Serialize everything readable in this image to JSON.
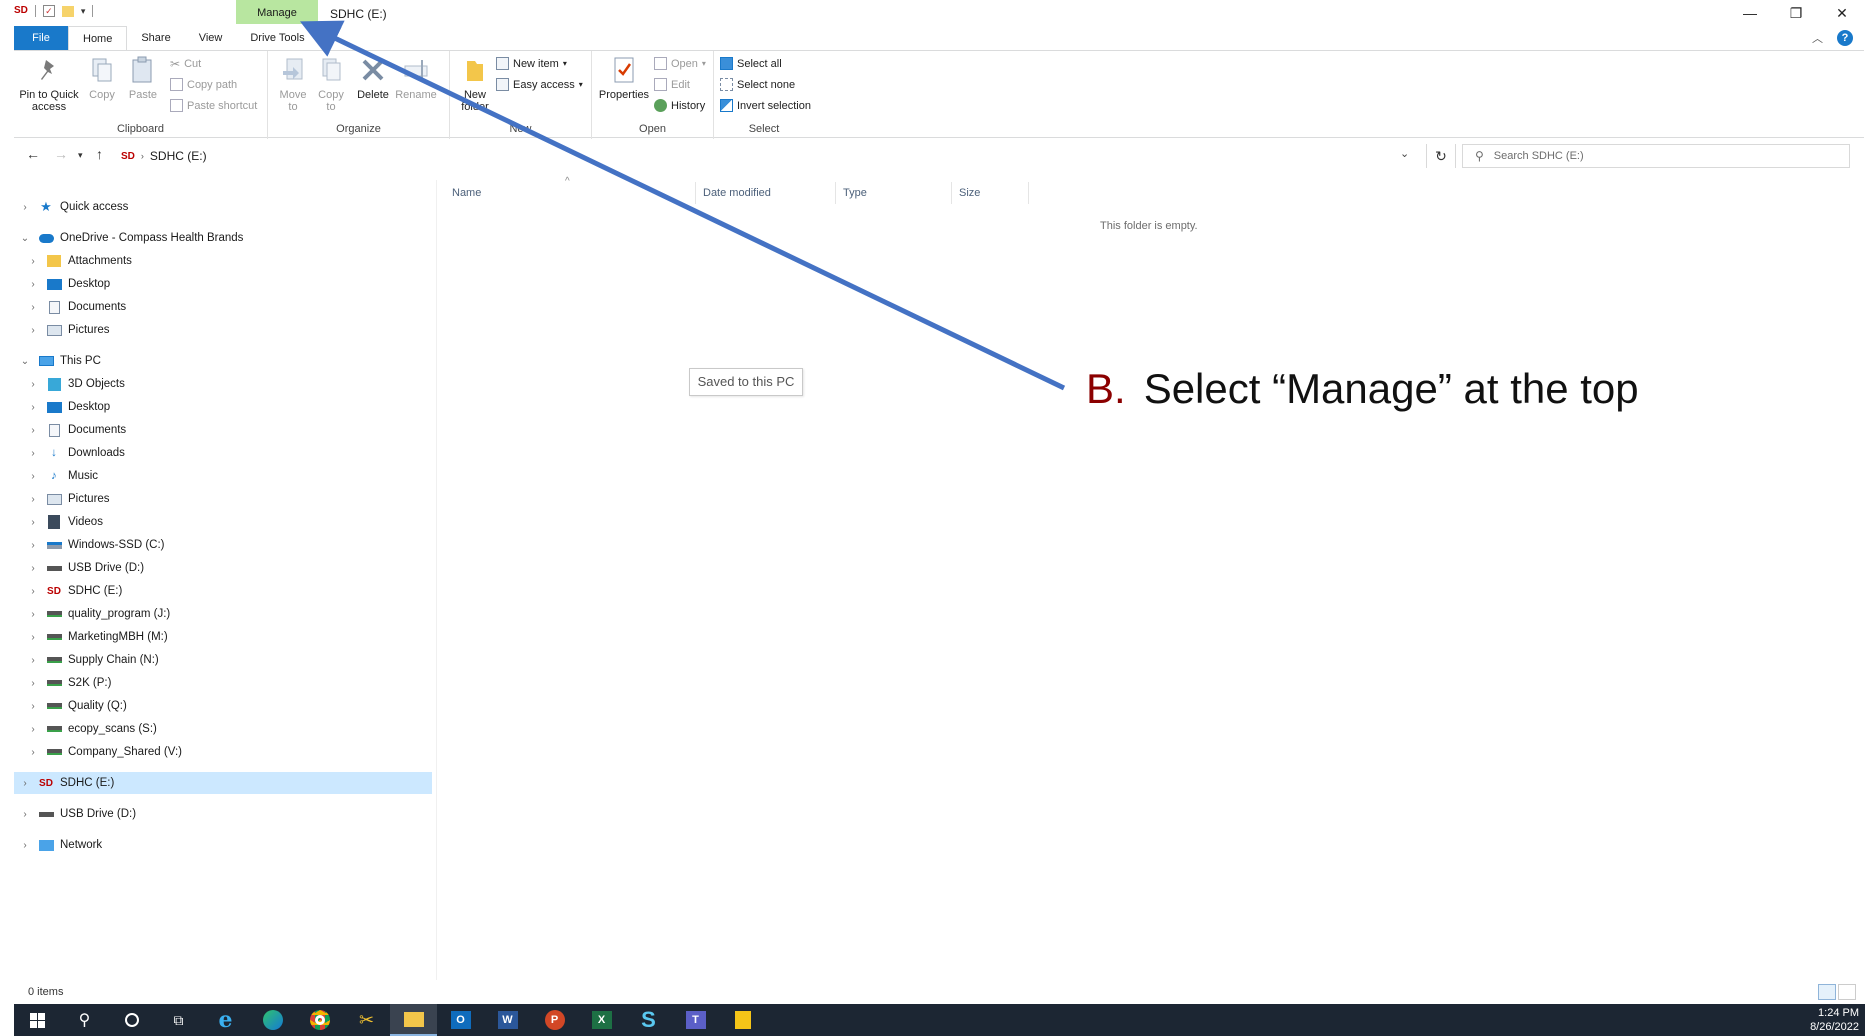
{
  "titlebar": {
    "manage_tab": "Manage",
    "window_title": "SDHC (E:)",
    "minimize": "—",
    "restore": "❐",
    "close": "✕"
  },
  "tabs": {
    "file": "File",
    "home": "Home",
    "share": "Share",
    "view": "View",
    "drive_tools": "Drive Tools"
  },
  "ribbon": {
    "clipboard": {
      "pin": "Pin to Quick access",
      "copy": "Copy",
      "paste": "Paste",
      "cut": "Cut",
      "copy_path": "Copy path",
      "paste_shortcut": "Paste shortcut",
      "label": "Clipboard"
    },
    "organize": {
      "move_to": "Move to",
      "copy_to": "Copy to",
      "delete": "Delete",
      "rename": "Rename",
      "label": "Organize"
    },
    "new": {
      "new_folder": "New folder",
      "new_item": "New item",
      "easy_access": "Easy access",
      "label": "New"
    },
    "open": {
      "properties": "Properties",
      "open": "Open",
      "edit": "Edit",
      "history": "History",
      "label": "Open"
    },
    "select": {
      "select_all": "Select all",
      "select_none": "Select none",
      "invert": "Invert selection",
      "label": "Select"
    }
  },
  "address": {
    "path": "SDHC (E:)",
    "search_placeholder": "Search SDHC (E:)"
  },
  "nav": {
    "quick_access": "Quick access",
    "onedrive": "OneDrive - Compass Health Brands",
    "od_attachments": "Attachments",
    "od_desktop": "Desktop",
    "od_documents": "Documents",
    "od_pictures": "Pictures",
    "this_pc": "This PC",
    "objects3d": "3D Objects",
    "desktop": "Desktop",
    "documents": "Documents",
    "downloads": "Downloads",
    "music": "Music",
    "pictures": "Pictures",
    "videos": "Videos",
    "windows_ssd": "Windows-SSD (C:)",
    "usb_d": "USB Drive (D:)",
    "sdhc_e": "SDHC (E:)",
    "quality_program": "quality_program (J:)",
    "marketing": "MarketingMBH (M:)",
    "supply_chain": "Supply Chain (N:)",
    "s2k": "S2K (P:)",
    "quality_q": "Quality (Q:)",
    "ecopy": "ecopy_scans (S:)",
    "company_shared": "Company_Shared (V:)",
    "sdhc_root": "SDHC (E:)",
    "usb_root": "USB Drive (D:)",
    "network": "Network"
  },
  "columns": {
    "name": "Name",
    "date_modified": "Date modified",
    "type": "Type",
    "size": "Size"
  },
  "content": {
    "empty_message": "This folder is empty.",
    "tooltip": "Saved to this PC"
  },
  "annotation": {
    "letter": "B.",
    "text": "Select “Manage” at the top"
  },
  "status": {
    "items": "0 items"
  },
  "clock": {
    "time": "1:24 PM",
    "date": "8/26/2022"
  },
  "colors": {
    "accent": "#1979ca",
    "manage_tab": "#b8e6a0",
    "selection": "#cce8ff",
    "arrow": "#4472c4",
    "annotation_letter": "#8b0000",
    "taskbar": "#1c2633"
  }
}
